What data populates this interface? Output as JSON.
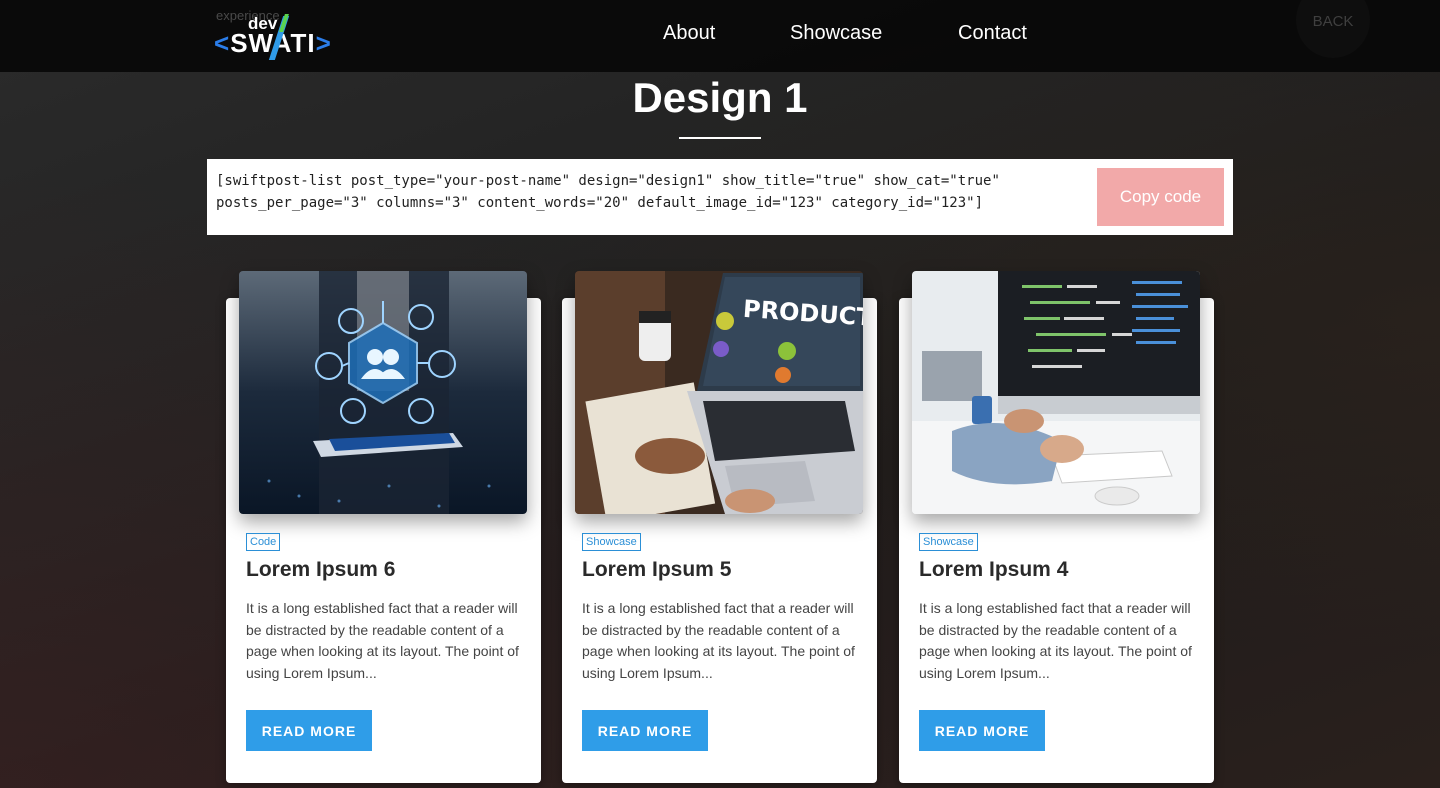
{
  "header": {
    "ghost_text": "experience",
    "logo": {
      "top": "dev",
      "left_bracket": "<",
      "name": "SWATI",
      "right_bracket": ">"
    },
    "nav": [
      "About",
      "Showcase",
      "Contact"
    ],
    "back_label": "BACK"
  },
  "page": {
    "title": "Design 1",
    "shortcode": "[swiftpost-list post_type=\"your-post-name\" design=\"design1\" show_title=\"true\" show_cat=\"true\" posts_per_page=\"3\" columns=\"3\" content_words=\"20\" default_image_id=\"123\" category_id=\"123\"]",
    "copy_label": "Copy code"
  },
  "cards": [
    {
      "category": "Code",
      "title": "Lorem Ipsum 6",
      "excerpt": "It is a long established fact that a reader will be distracted by the readable content of a page when looking at its layout. The point of using Lorem Ipsum...",
      "button": "READ MORE"
    },
    {
      "category": "Showcase",
      "title": "Lorem Ipsum 5",
      "excerpt": "It is a long established fact that a reader will be distracted by the readable content of a page when looking at its layout. The point of using Lorem Ipsum...",
      "button": "READ MORE",
      "image_text": "PRODUCT"
    },
    {
      "category": "Showcase",
      "title": "Lorem Ipsum 4",
      "excerpt": "It is a long established fact that a reader will be distracted by the readable content of a page when looking at its layout. The point of using Lorem Ipsum...",
      "button": "READ MORE"
    }
  ],
  "colors": {
    "accent": "#2f9de8",
    "copy_button": "#f2a9a9",
    "header_bg": "#080808"
  }
}
